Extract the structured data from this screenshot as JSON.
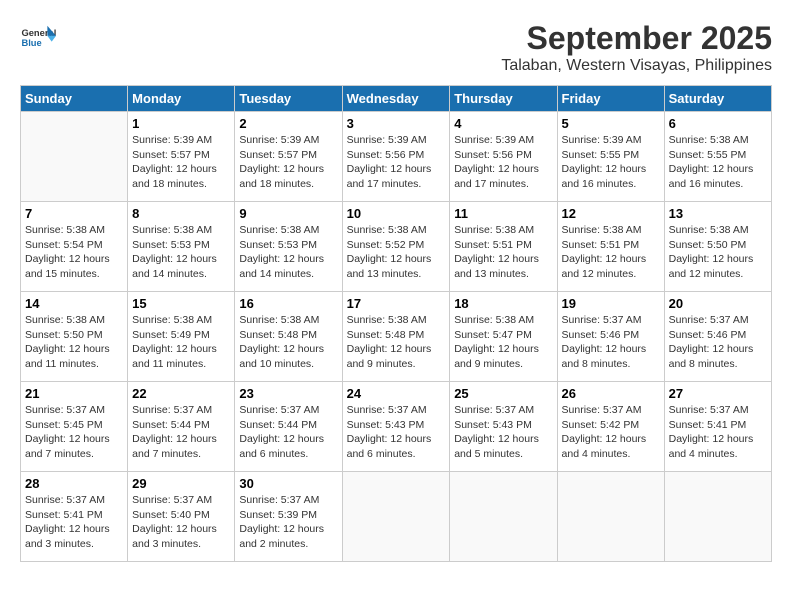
{
  "header": {
    "logo_line1": "General",
    "logo_line2": "Blue",
    "month": "September 2025",
    "location": "Talaban, Western Visayas, Philippines"
  },
  "weekdays": [
    "Sunday",
    "Monday",
    "Tuesday",
    "Wednesday",
    "Thursday",
    "Friday",
    "Saturday"
  ],
  "weeks": [
    [
      {
        "day": null,
        "info": null
      },
      {
        "day": "1",
        "sunrise": "5:39 AM",
        "sunset": "5:57 PM",
        "daylight": "12 hours and 18 minutes."
      },
      {
        "day": "2",
        "sunrise": "5:39 AM",
        "sunset": "5:57 PM",
        "daylight": "12 hours and 18 minutes."
      },
      {
        "day": "3",
        "sunrise": "5:39 AM",
        "sunset": "5:56 PM",
        "daylight": "12 hours and 17 minutes."
      },
      {
        "day": "4",
        "sunrise": "5:39 AM",
        "sunset": "5:56 PM",
        "daylight": "12 hours and 17 minutes."
      },
      {
        "day": "5",
        "sunrise": "5:39 AM",
        "sunset": "5:55 PM",
        "daylight": "12 hours and 16 minutes."
      },
      {
        "day": "6",
        "sunrise": "5:38 AM",
        "sunset": "5:55 PM",
        "daylight": "12 hours and 16 minutes."
      }
    ],
    [
      {
        "day": "7",
        "sunrise": "5:38 AM",
        "sunset": "5:54 PM",
        "daylight": "12 hours and 15 minutes."
      },
      {
        "day": "8",
        "sunrise": "5:38 AM",
        "sunset": "5:53 PM",
        "daylight": "12 hours and 14 minutes."
      },
      {
        "day": "9",
        "sunrise": "5:38 AM",
        "sunset": "5:53 PM",
        "daylight": "12 hours and 14 minutes."
      },
      {
        "day": "10",
        "sunrise": "5:38 AM",
        "sunset": "5:52 PM",
        "daylight": "12 hours and 13 minutes."
      },
      {
        "day": "11",
        "sunrise": "5:38 AM",
        "sunset": "5:51 PM",
        "daylight": "12 hours and 13 minutes."
      },
      {
        "day": "12",
        "sunrise": "5:38 AM",
        "sunset": "5:51 PM",
        "daylight": "12 hours and 12 minutes."
      },
      {
        "day": "13",
        "sunrise": "5:38 AM",
        "sunset": "5:50 PM",
        "daylight": "12 hours and 12 minutes."
      }
    ],
    [
      {
        "day": "14",
        "sunrise": "5:38 AM",
        "sunset": "5:50 PM",
        "daylight": "12 hours and 11 minutes."
      },
      {
        "day": "15",
        "sunrise": "5:38 AM",
        "sunset": "5:49 PM",
        "daylight": "12 hours and 11 minutes."
      },
      {
        "day": "16",
        "sunrise": "5:38 AM",
        "sunset": "5:48 PM",
        "daylight": "12 hours and 10 minutes."
      },
      {
        "day": "17",
        "sunrise": "5:38 AM",
        "sunset": "5:48 PM",
        "daylight": "12 hours and 9 minutes."
      },
      {
        "day": "18",
        "sunrise": "5:38 AM",
        "sunset": "5:47 PM",
        "daylight": "12 hours and 9 minutes."
      },
      {
        "day": "19",
        "sunrise": "5:37 AM",
        "sunset": "5:46 PM",
        "daylight": "12 hours and 8 minutes."
      },
      {
        "day": "20",
        "sunrise": "5:37 AM",
        "sunset": "5:46 PM",
        "daylight": "12 hours and 8 minutes."
      }
    ],
    [
      {
        "day": "21",
        "sunrise": "5:37 AM",
        "sunset": "5:45 PM",
        "daylight": "12 hours and 7 minutes."
      },
      {
        "day": "22",
        "sunrise": "5:37 AM",
        "sunset": "5:44 PM",
        "daylight": "12 hours and 7 minutes."
      },
      {
        "day": "23",
        "sunrise": "5:37 AM",
        "sunset": "5:44 PM",
        "daylight": "12 hours and 6 minutes."
      },
      {
        "day": "24",
        "sunrise": "5:37 AM",
        "sunset": "5:43 PM",
        "daylight": "12 hours and 6 minutes."
      },
      {
        "day": "25",
        "sunrise": "5:37 AM",
        "sunset": "5:43 PM",
        "daylight": "12 hours and 5 minutes."
      },
      {
        "day": "26",
        "sunrise": "5:37 AM",
        "sunset": "5:42 PM",
        "daylight": "12 hours and 4 minutes."
      },
      {
        "day": "27",
        "sunrise": "5:37 AM",
        "sunset": "5:41 PM",
        "daylight": "12 hours and 4 minutes."
      }
    ],
    [
      {
        "day": "28",
        "sunrise": "5:37 AM",
        "sunset": "5:41 PM",
        "daylight": "12 hours and 3 minutes."
      },
      {
        "day": "29",
        "sunrise": "5:37 AM",
        "sunset": "5:40 PM",
        "daylight": "12 hours and 3 minutes."
      },
      {
        "day": "30",
        "sunrise": "5:37 AM",
        "sunset": "5:39 PM",
        "daylight": "12 hours and 2 minutes."
      },
      {
        "day": null,
        "info": null
      },
      {
        "day": null,
        "info": null
      },
      {
        "day": null,
        "info": null
      },
      {
        "day": null,
        "info": null
      }
    ]
  ]
}
